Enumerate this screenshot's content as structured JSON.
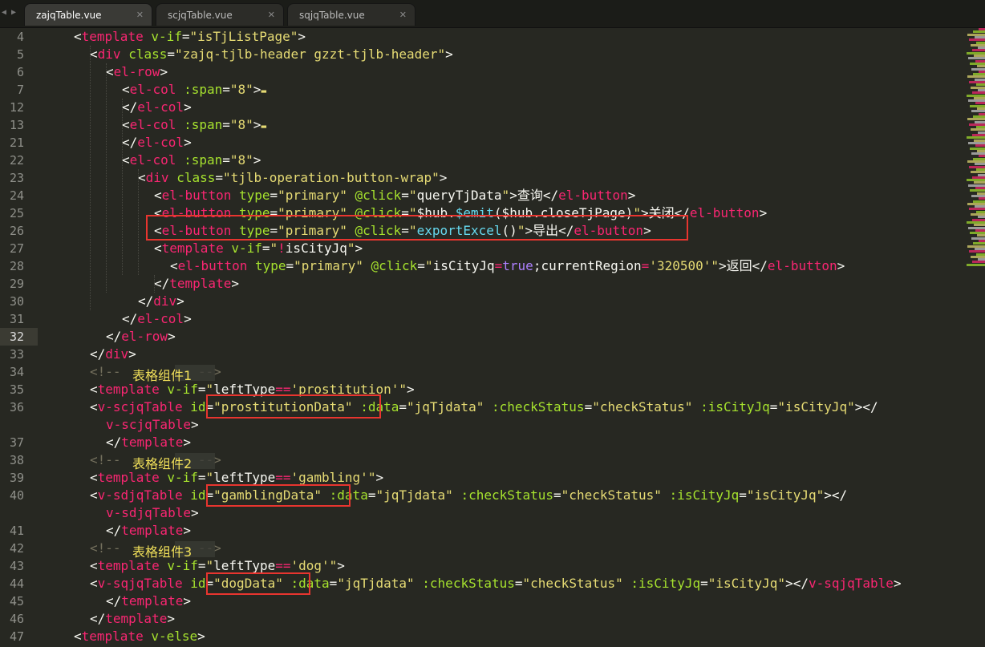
{
  "tabs": [
    {
      "label": "zajqTable.vue",
      "active": true
    },
    {
      "label": "scjqTable.vue",
      "active": false
    },
    {
      "label": "sqjqTable.vue",
      "active": false
    }
  ],
  "tab_close_glyph": "✕",
  "nav_glyph": "◀ ▶",
  "current_line": 32,
  "colors": {
    "background": "#272822",
    "tag": "#f92672",
    "attribute": "#a6e22e",
    "string": "#e6db74",
    "function": "#66d9ef",
    "constant": "#ae81ff",
    "comment": "#75715e",
    "highlight": "#e8352f",
    "annotation": "#f1e05a"
  },
  "annotations": [
    "表格组件1",
    "表格组件2",
    "表格组件3"
  ],
  "lines": [
    {
      "n": "4",
      "tokens": [
        [
          "p",
          "<"
        ],
        [
          "tag",
          "template"
        ],
        [
          "p",
          " "
        ],
        [
          "attr",
          "v-if"
        ],
        [
          "p",
          "="
        ],
        [
          "str",
          "\"isTjListPage\""
        ],
        [
          "p",
          ">"
        ]
      ]
    },
    {
      "n": "5",
      "tokens": [
        [
          "p",
          "<"
        ],
        [
          "tag",
          "div"
        ],
        [
          "p",
          " "
        ],
        [
          "attr",
          "class"
        ],
        [
          "p",
          "="
        ],
        [
          "str",
          "\"zajq-tjlb-header gzzt-tjlb-header\""
        ],
        [
          "p",
          ">"
        ]
      ]
    },
    {
      "n": "6",
      "tokens": [
        [
          "p",
          "<"
        ],
        [
          "tag",
          "el-row"
        ],
        [
          "p",
          ">"
        ]
      ]
    },
    {
      "n": "7",
      "tokens": [
        [
          "p",
          "<"
        ],
        [
          "tag",
          "el-col"
        ],
        [
          "p",
          " "
        ],
        [
          "attr",
          ":span"
        ],
        [
          "p",
          "="
        ],
        [
          "str",
          "\"8\""
        ],
        [
          "p",
          ">"
        ],
        [
          "fold",
          "▬"
        ]
      ]
    },
    {
      "n": "12",
      "tokens": [
        [
          "p",
          "</"
        ],
        [
          "tag",
          "el-col"
        ],
        [
          "p",
          ">"
        ]
      ]
    },
    {
      "n": "13",
      "tokens": [
        [
          "p",
          "<"
        ],
        [
          "tag",
          "el-col"
        ],
        [
          "p",
          " "
        ],
        [
          "attr",
          ":span"
        ],
        [
          "p",
          "="
        ],
        [
          "str",
          "\"8\""
        ],
        [
          "p",
          ">"
        ],
        [
          "fold",
          "▬"
        ]
      ]
    },
    {
      "n": "21",
      "tokens": [
        [
          "p",
          "</"
        ],
        [
          "tag",
          "el-col"
        ],
        [
          "p",
          ">"
        ]
      ]
    },
    {
      "n": "22",
      "tokens": [
        [
          "p",
          "<"
        ],
        [
          "tag",
          "el-col"
        ],
        [
          "p",
          " "
        ],
        [
          "attr",
          ":span"
        ],
        [
          "p",
          "="
        ],
        [
          "str",
          "\"8\""
        ],
        [
          "p",
          ">"
        ]
      ]
    },
    {
      "n": "23",
      "tokens": [
        [
          "p",
          "<"
        ],
        [
          "tag",
          "div"
        ],
        [
          "p",
          " "
        ],
        [
          "attr",
          "class"
        ],
        [
          "p",
          "="
        ],
        [
          "str",
          "\"tjlb-operation-button-wrap\""
        ],
        [
          "p",
          ">"
        ]
      ]
    },
    {
      "n": "24",
      "tokens": [
        [
          "p",
          "<"
        ],
        [
          "tag",
          "el-button"
        ],
        [
          "p",
          " "
        ],
        [
          "attr",
          "type"
        ],
        [
          "p",
          "="
        ],
        [
          "str",
          "\"primary\""
        ],
        [
          "p",
          " "
        ],
        [
          "attr",
          "@click"
        ],
        [
          "p",
          "="
        ],
        [
          "str",
          "\""
        ],
        [
          "p",
          "queryTjData"
        ],
        [
          "str",
          "\""
        ],
        [
          "p",
          ">查询</"
        ],
        [
          "tag",
          "el-button"
        ],
        [
          "p",
          ">"
        ]
      ]
    },
    {
      "n": "25",
      "tokens": [
        [
          "p",
          "<"
        ],
        [
          "tag",
          "el-button"
        ],
        [
          "p",
          " "
        ],
        [
          "attr",
          "type"
        ],
        [
          "p",
          "="
        ],
        [
          "str",
          "\"primary\""
        ],
        [
          "p",
          " "
        ],
        [
          "attr",
          "@click"
        ],
        [
          "p",
          "="
        ],
        [
          "str",
          "\""
        ],
        [
          "p",
          "$hub."
        ],
        [
          "fn",
          "$emit"
        ],
        [
          "p",
          "($hub.closeTjPage)"
        ],
        [
          "str",
          "\""
        ],
        [
          "p",
          ">关闭</"
        ],
        [
          "tag",
          "el-button"
        ],
        [
          "p",
          ">"
        ]
      ]
    },
    {
      "n": "26",
      "tokens": [
        [
          "p",
          "<"
        ],
        [
          "tag",
          "el-button"
        ],
        [
          "p",
          " "
        ],
        [
          "attr",
          "type"
        ],
        [
          "p",
          "="
        ],
        [
          "str",
          "\"primary\""
        ],
        [
          "p",
          " "
        ],
        [
          "attr",
          "@click"
        ],
        [
          "p",
          "="
        ],
        [
          "str",
          "\""
        ],
        [
          "fn",
          "exportExcel"
        ],
        [
          "p",
          "()"
        ],
        [
          "str",
          "\""
        ],
        [
          "p",
          ">导出</"
        ],
        [
          "tag",
          "el-button"
        ],
        [
          "p",
          ">"
        ]
      ]
    },
    {
      "n": "27",
      "tokens": [
        [
          "p",
          "<"
        ],
        [
          "tag",
          "template"
        ],
        [
          "p",
          " "
        ],
        [
          "attr",
          "v-if"
        ],
        [
          "p",
          "="
        ],
        [
          "str",
          "\""
        ],
        [
          "eq",
          "!"
        ],
        [
          "p",
          "isCityJq"
        ],
        [
          "str",
          "\""
        ],
        [
          "p",
          ">"
        ]
      ]
    },
    {
      "n": "28",
      "tokens": [
        [
          "p",
          "<"
        ],
        [
          "tag",
          "el-button"
        ],
        [
          "p",
          " "
        ],
        [
          "attr",
          "type"
        ],
        [
          "p",
          "="
        ],
        [
          "str",
          "\"primary\""
        ],
        [
          "p",
          " "
        ],
        [
          "attr",
          "@click"
        ],
        [
          "p",
          "="
        ],
        [
          "str",
          "\""
        ],
        [
          "p",
          "isCityJq"
        ],
        [
          "eq",
          "="
        ],
        [
          "kw",
          "true"
        ],
        [
          "p",
          ";currentRegion"
        ],
        [
          "eq",
          "="
        ],
        [
          "str",
          "'320500'"
        ],
        [
          "str",
          "\""
        ],
        [
          "p",
          ">返回</"
        ],
        [
          "tag",
          "el-button"
        ],
        [
          "p",
          ">"
        ]
      ]
    },
    {
      "n": "29",
      "tokens": [
        [
          "p",
          "</"
        ],
        [
          "tag",
          "template"
        ],
        [
          "p",
          ">"
        ]
      ]
    },
    {
      "n": "30",
      "tokens": [
        [
          "p",
          "</"
        ],
        [
          "tag",
          "div"
        ],
        [
          "p",
          ">"
        ]
      ]
    },
    {
      "n": "31",
      "tokens": [
        [
          "p",
          "</"
        ],
        [
          "tag",
          "el-col"
        ],
        [
          "p",
          ">"
        ]
      ]
    },
    {
      "n": "32",
      "tokens": [
        [
          "p",
          "</"
        ],
        [
          "tag",
          "el-row"
        ],
        [
          "p",
          ">"
        ]
      ]
    },
    {
      "n": "33",
      "tokens": [
        [
          "p",
          "</"
        ],
        [
          "tag",
          "div"
        ],
        [
          "p",
          ">"
        ]
      ]
    },
    {
      "n": "34",
      "tokens": [
        [
          "cmt",
          "<!--          -->"
        ]
      ]
    },
    {
      "n": "35",
      "tokens": [
        [
          "p",
          "<"
        ],
        [
          "tag",
          "template"
        ],
        [
          "p",
          " "
        ],
        [
          "attr",
          "v-if"
        ],
        [
          "p",
          "="
        ],
        [
          "str",
          "\""
        ],
        [
          "p",
          "leftType"
        ],
        [
          "eq",
          "=="
        ],
        [
          "str",
          "'prostitution'"
        ],
        [
          "str",
          "\""
        ],
        [
          "p",
          ">"
        ]
      ]
    },
    {
      "n": "36",
      "tokens": [
        [
          "p",
          "<"
        ],
        [
          "tag",
          "v-scjqTable"
        ],
        [
          "p",
          " "
        ],
        [
          "attr",
          "id"
        ],
        [
          "p",
          "="
        ],
        [
          "str",
          "\"prostitutionData\""
        ],
        [
          "p",
          " "
        ],
        [
          "attr",
          ":data"
        ],
        [
          "p",
          "="
        ],
        [
          "str",
          "\"jqTjdata\""
        ],
        [
          "p",
          " "
        ],
        [
          "attr",
          ":checkStatus"
        ],
        [
          "p",
          "="
        ],
        [
          "str",
          "\"checkStatus\""
        ],
        [
          "p",
          " "
        ],
        [
          "attr",
          ":isCityJq"
        ],
        [
          "p",
          "="
        ],
        [
          "str",
          "\"isCityJq\""
        ],
        [
          "p",
          "></"
        ]
      ]
    },
    {
      "n": "",
      "tokens": [
        [
          "tag",
          "v-scjqTable"
        ],
        [
          "p",
          ">"
        ]
      ]
    },
    {
      "n": "37",
      "tokens": [
        [
          "p",
          "</"
        ],
        [
          "tag",
          "template"
        ],
        [
          "p",
          ">"
        ]
      ]
    },
    {
      "n": "38",
      "tokens": [
        [
          "cmt",
          "<!--          -->"
        ]
      ]
    },
    {
      "n": "39",
      "tokens": [
        [
          "p",
          "<"
        ],
        [
          "tag",
          "template"
        ],
        [
          "p",
          " "
        ],
        [
          "attr",
          "v-if"
        ],
        [
          "p",
          "="
        ],
        [
          "str",
          "\""
        ],
        [
          "p",
          "leftType"
        ],
        [
          "eq",
          "=="
        ],
        [
          "str",
          "'gambling'"
        ],
        [
          "str",
          "\""
        ],
        [
          "p",
          ">"
        ]
      ]
    },
    {
      "n": "40",
      "tokens": [
        [
          "p",
          "<"
        ],
        [
          "tag",
          "v-sdjqTable"
        ],
        [
          "p",
          " "
        ],
        [
          "attr",
          "id"
        ],
        [
          "p",
          "="
        ],
        [
          "str",
          "\"gamblingData\""
        ],
        [
          "p",
          " "
        ],
        [
          "attr",
          ":data"
        ],
        [
          "p",
          "="
        ],
        [
          "str",
          "\"jqTjdata\""
        ],
        [
          "p",
          " "
        ],
        [
          "attr",
          ":checkStatus"
        ],
        [
          "p",
          "="
        ],
        [
          "str",
          "\"checkStatus\""
        ],
        [
          "p",
          " "
        ],
        [
          "attr",
          ":isCityJq"
        ],
        [
          "p",
          "="
        ],
        [
          "str",
          "\"isCityJq\""
        ],
        [
          "p",
          "></"
        ]
      ]
    },
    {
      "n": "",
      "tokens": [
        [
          "tag",
          "v-sdjqTable"
        ],
        [
          "p",
          ">"
        ]
      ]
    },
    {
      "n": "41",
      "tokens": [
        [
          "p",
          "</"
        ],
        [
          "tag",
          "template"
        ],
        [
          "p",
          ">"
        ]
      ]
    },
    {
      "n": "42",
      "tokens": [
        [
          "cmt",
          "<!--          -->"
        ]
      ]
    },
    {
      "n": "43",
      "tokens": [
        [
          "p",
          "<"
        ],
        [
          "tag",
          "template"
        ],
        [
          "p",
          " "
        ],
        [
          "attr",
          "v-if"
        ],
        [
          "p",
          "="
        ],
        [
          "str",
          "\""
        ],
        [
          "p",
          "leftType"
        ],
        [
          "eq",
          "=="
        ],
        [
          "str",
          "'dog'"
        ],
        [
          "str",
          "\""
        ],
        [
          "p",
          ">"
        ]
      ]
    },
    {
      "n": "44",
      "tokens": [
        [
          "p",
          "<"
        ],
        [
          "tag",
          "v-sqjqTable"
        ],
        [
          "p",
          " "
        ],
        [
          "attr",
          "id"
        ],
        [
          "p",
          "="
        ],
        [
          "str",
          "\"dogData\""
        ],
        [
          "p",
          " "
        ],
        [
          "attr",
          ":data"
        ],
        [
          "p",
          "="
        ],
        [
          "str",
          "\"jqTjdata\""
        ],
        [
          "p",
          " "
        ],
        [
          "attr",
          ":checkStatus"
        ],
        [
          "p",
          "="
        ],
        [
          "str",
          "\"checkStatus\""
        ],
        [
          "p",
          " "
        ],
        [
          "attr",
          ":isCityJq"
        ],
        [
          "p",
          "="
        ],
        [
          "str",
          "\"isCityJq\""
        ],
        [
          "p",
          "></"
        ],
        [
          "tag",
          "v-sqjqTable"
        ],
        [
          "p",
          ">"
        ]
      ]
    },
    {
      "n": "45",
      "tokens": [
        [
          "p",
          "</"
        ],
        [
          "tag",
          "template"
        ],
        [
          "p",
          ">"
        ]
      ]
    },
    {
      "n": "46",
      "tokens": [
        [
          "p",
          "</"
        ],
        [
          "tag",
          "template"
        ],
        [
          "p",
          ">"
        ]
      ]
    },
    {
      "n": "47",
      "tokens": [
        [
          "p",
          "<"
        ],
        [
          "tag",
          "template"
        ],
        [
          "p",
          " "
        ],
        [
          "attr",
          "v-else"
        ],
        [
          "p",
          ">"
        ]
      ]
    }
  ]
}
